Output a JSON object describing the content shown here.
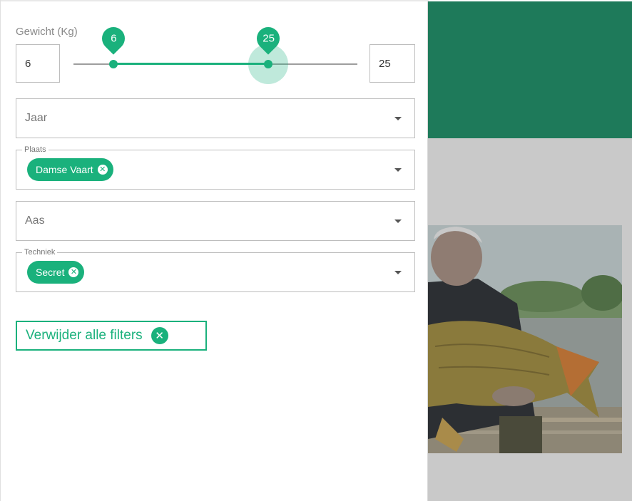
{
  "colors": {
    "accent": "#1ab17c",
    "header_green": "#1e7a5a",
    "overlay_grey": "#c9c9c9"
  },
  "filters": {
    "weight": {
      "label": "Gewicht (Kg)",
      "min_value": "6",
      "max_value": "25",
      "slider_min_label": "6",
      "slider_max_label": "25"
    },
    "jaar": {
      "placeholder": "Jaar"
    },
    "plaats": {
      "legend": "Plaats",
      "chip": "Damse Vaart"
    },
    "aas": {
      "placeholder": "Aas"
    },
    "techniek": {
      "legend": "Techniek",
      "chip": "Secret"
    }
  },
  "actions": {
    "clear_all_label": "Verwijder alle filters"
  },
  "icons": {
    "dropdown": "caret-down-icon",
    "chip_delete": "cancel-circle-icon",
    "clear_all": "cancel-circle-icon"
  }
}
